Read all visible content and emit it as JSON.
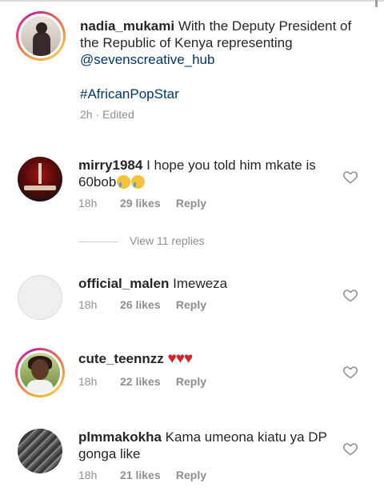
{
  "caption": {
    "username": "nadia_mukami",
    "text": "With the Deputy President of the Republic of Kenya representing",
    "mention": "@sevenscreative_hub",
    "hashtag": "#AfricanPopStar",
    "time": "2h",
    "edited": "Edited"
  },
  "comments": [
    {
      "username": "mirry1984",
      "text": "I hope you told him mkate is 60bob",
      "emoji": "😢😢",
      "time": "18h",
      "likes": "29 likes",
      "reply": "Reply"
    },
    {
      "username": "official_malen",
      "text": "Imeweza",
      "time": "18h",
      "likes": "26 likes",
      "reply": "Reply"
    },
    {
      "username": "cute_teennzz",
      "text": "♥♥♥",
      "time": "18h",
      "likes": "22 likes",
      "reply": "Reply"
    },
    {
      "username": "plmmakokha",
      "text": "Kama umeona kiatu ya DP gonga like",
      "time": "18h",
      "likes": "21 likes",
      "reply": "Reply"
    }
  ],
  "view_replies": "View 11 replies",
  "icons": {
    "like": "heart-outline-icon"
  },
  "colors": {
    "link": "#00376b",
    "meta": "#8e8e8e",
    "hearts": "#d8232a"
  }
}
